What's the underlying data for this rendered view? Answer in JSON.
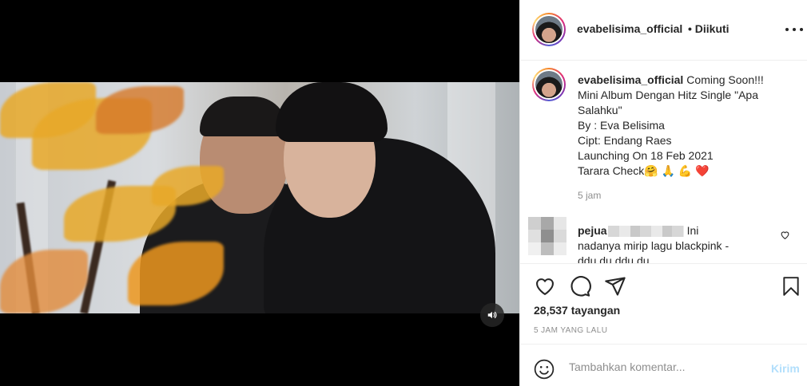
{
  "post": {
    "username": "evabelisima_official",
    "follow_status": "• Diikuti",
    "caption_lines": [
      "Coming Soon!!!",
      "Mini Album Dengan Hitz Single \"Apa",
      "Salahku\"",
      "By : Eva Belisima",
      "Cipt: Endang Raes",
      "Launching On 18 Feb 2021",
      "Tarara Check🤗 🙏 💪 ❤️"
    ],
    "caption_timestamp": "5 jam",
    "views_count": "28,537",
    "views_label": "tayangan",
    "posted_ago": "5 JAM YANG LALU"
  },
  "comment": {
    "username_visible": "pejua",
    "text_line1": "Ini",
    "text_line2": "nadanya mirip lagu blackpink -",
    "text_line3": "ddu du ddu du"
  },
  "add_comment": {
    "placeholder": "Tambahkan komentar...",
    "post_label": "Kirim"
  },
  "icons": {
    "more": "more-horizontal-icon",
    "sound": "speaker-icon",
    "like": "heart-icon",
    "comment": "comment-bubble-icon",
    "share": "paper-plane-icon",
    "save": "bookmark-icon",
    "emoji": "emoji-smile-icon"
  },
  "colors": {
    "link_disabled": "#b2dffc",
    "muted_text": "#8e8e8e",
    "primary_text": "#262626"
  }
}
